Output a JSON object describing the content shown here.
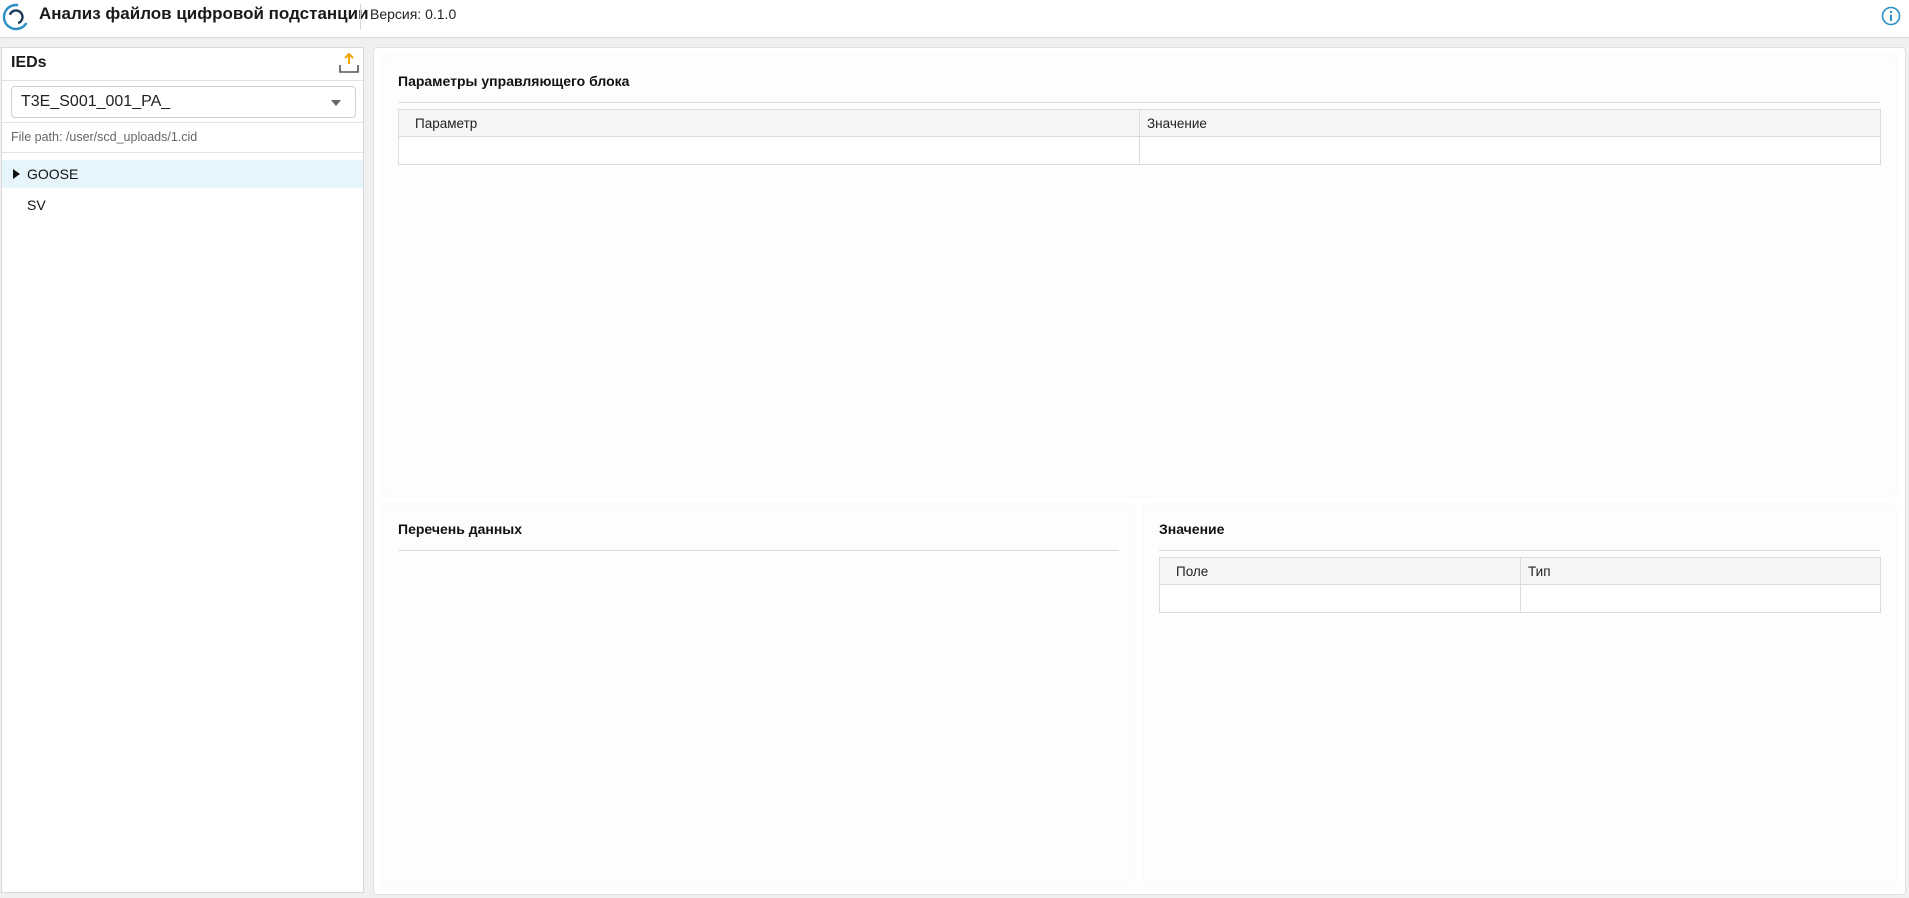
{
  "header": {
    "app_title": "Анализ файлов цифровой подстанции",
    "version": "Версия: 0.1.0",
    "logo_icon": "substation-logo-icon",
    "info_icon": "info-icon",
    "accent_color": "#2a8fc7"
  },
  "sidebar": {
    "title": "IEDs",
    "upload_icon": "upload-icon",
    "ied_select": {
      "selected": "T3E_S001_001_PA_"
    },
    "file_path": "File path: /user/scd_uploads/1.cid",
    "tree": [
      {
        "label": "GOOSE",
        "expandable": true,
        "selected": true
      },
      {
        "label": "SV",
        "expandable": false,
        "selected": false
      }
    ]
  },
  "main": {
    "control_block": {
      "title": "Параметры управляющего блока",
      "columns": [
        "Параметр",
        "Значение"
      ],
      "rows": [
        [
          "",
          ""
        ]
      ]
    },
    "dataset": {
      "title": "Перечень данных"
    },
    "value": {
      "title": "Значение",
      "columns": [
        "Поле",
        "Тип"
      ],
      "rows": [
        [
          "",
          ""
        ]
      ]
    }
  }
}
